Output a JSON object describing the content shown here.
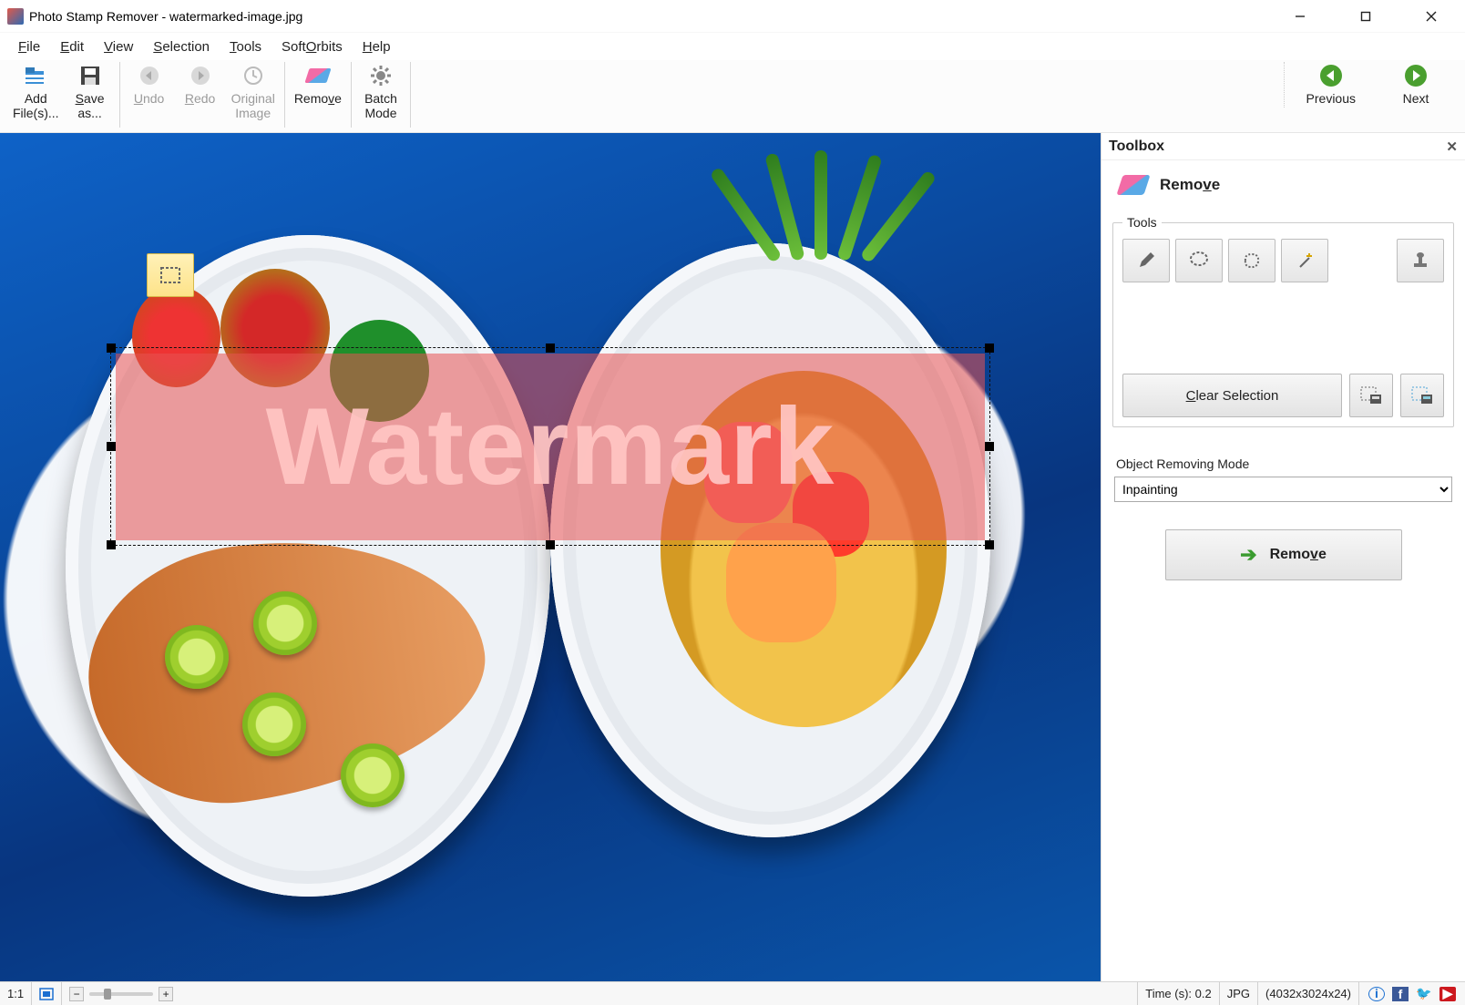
{
  "titlebar": {
    "title": "Photo Stamp Remover - watermarked-image.jpg"
  },
  "menu": {
    "file": "File",
    "edit": "Edit",
    "view": "View",
    "selection": "Selection",
    "tools": "Tools",
    "softorbits": "SoftOrbits",
    "help": "Help"
  },
  "toolbar": {
    "add_files": "Add File(s)...",
    "save_as": "Save as...",
    "undo": "Undo",
    "redo": "Redo",
    "original_image": "Original Image",
    "remove": "Remove",
    "batch_mode": "Batch Mode",
    "previous": "Previous",
    "next": "Next"
  },
  "canvas": {
    "watermark_text": "Watermark"
  },
  "panel": {
    "title": "Toolbox",
    "remove_header": "Remove",
    "tools_legend": "Tools",
    "clear_selection": "Clear Selection",
    "mode_label": "Object Removing Mode",
    "mode_value": "Inpainting",
    "remove_btn": "Remove"
  },
  "status": {
    "zoom_label": "1:1",
    "time": "Time (s): 0.2",
    "format": "JPG",
    "dims": "(4032x3024x24)"
  }
}
